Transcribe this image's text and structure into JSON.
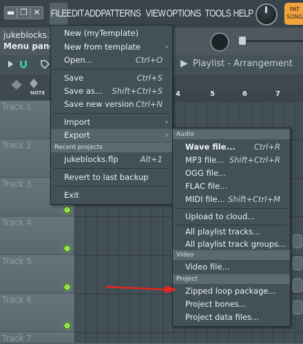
{
  "window": {
    "minimize_glyph": "▬",
    "restore_glyph": "❐",
    "close_glyph": "✕"
  },
  "menubar": {
    "items": [
      "FILE",
      "EDIT",
      "ADD",
      "PATTERNS",
      "VIEW",
      "OPTIONS",
      "TOOLS",
      "HELP"
    ],
    "active": "FILE"
  },
  "badge": {
    "line1": "PAT",
    "line2": "SONG",
    "color": "#f2a23a"
  },
  "project": {
    "file_title": "jukeblocks.flp",
    "hint": "Menu panel"
  },
  "playlist": {
    "arrow": "▶",
    "title": "Playlist - Arrangement",
    "separator": "▶",
    "note_label": "NOTE",
    "ruler": [
      "4",
      "5",
      "6",
      "7"
    ]
  },
  "tracks": [
    "Track 1",
    "Track 2",
    "Track 3",
    "Track 4",
    "Track 5",
    "Track 6",
    "Track 7"
  ],
  "file_menu": {
    "items": [
      {
        "label": "New (myTemplate)",
        "shortcut": ""
      },
      {
        "label": "New from template",
        "shortcut": "",
        "submenu": true
      },
      {
        "label": "Open...",
        "shortcut": "Ctrl+O"
      },
      {
        "label": "Save",
        "shortcut": "Ctrl+S"
      },
      {
        "label": "Save as...",
        "shortcut": "Shift+Ctrl+S"
      },
      {
        "label": "Save new version",
        "shortcut": "Ctrl+N"
      },
      {
        "label": "Import",
        "shortcut": "",
        "submenu": true
      },
      {
        "label": "Export",
        "shortcut": "",
        "submenu": true
      },
      {
        "label": "jukeblocks.flp",
        "shortcut": "Alt+1"
      },
      {
        "label": "Revert to last backup",
        "shortcut": ""
      },
      {
        "label": "Exit",
        "shortcut": ""
      }
    ],
    "recent_header": "Recent projects",
    "submenu_arrow": "›"
  },
  "export_menu": {
    "audio_header": "Audio",
    "video_header": "Video",
    "project_header": "Project",
    "items": [
      {
        "label": "Wave file...",
        "shortcut": "Ctrl+R"
      },
      {
        "label": "MP3 file...",
        "shortcut": "Shift+Ctrl+R"
      },
      {
        "label": "OGG file...",
        "shortcut": ""
      },
      {
        "label": "FLAC file...",
        "shortcut": ""
      },
      {
        "label": "MIDI file...",
        "shortcut": "Shift+Ctrl+M"
      },
      {
        "label": "Upload to cloud...",
        "shortcut": ""
      },
      {
        "label": "All playlist tracks...",
        "shortcut": ""
      },
      {
        "label": "All playlist track groups...",
        "shortcut": ""
      },
      {
        "label": "Video file...",
        "shortcut": ""
      },
      {
        "label": "Zipped loop package...",
        "shortcut": ""
      },
      {
        "label": "Project bones...",
        "shortcut": ""
      },
      {
        "label": "Project data files...",
        "shortcut": ""
      }
    ]
  },
  "colors": {
    "led": "#8ee04d",
    "annotation_arrow": "#e8241e"
  }
}
